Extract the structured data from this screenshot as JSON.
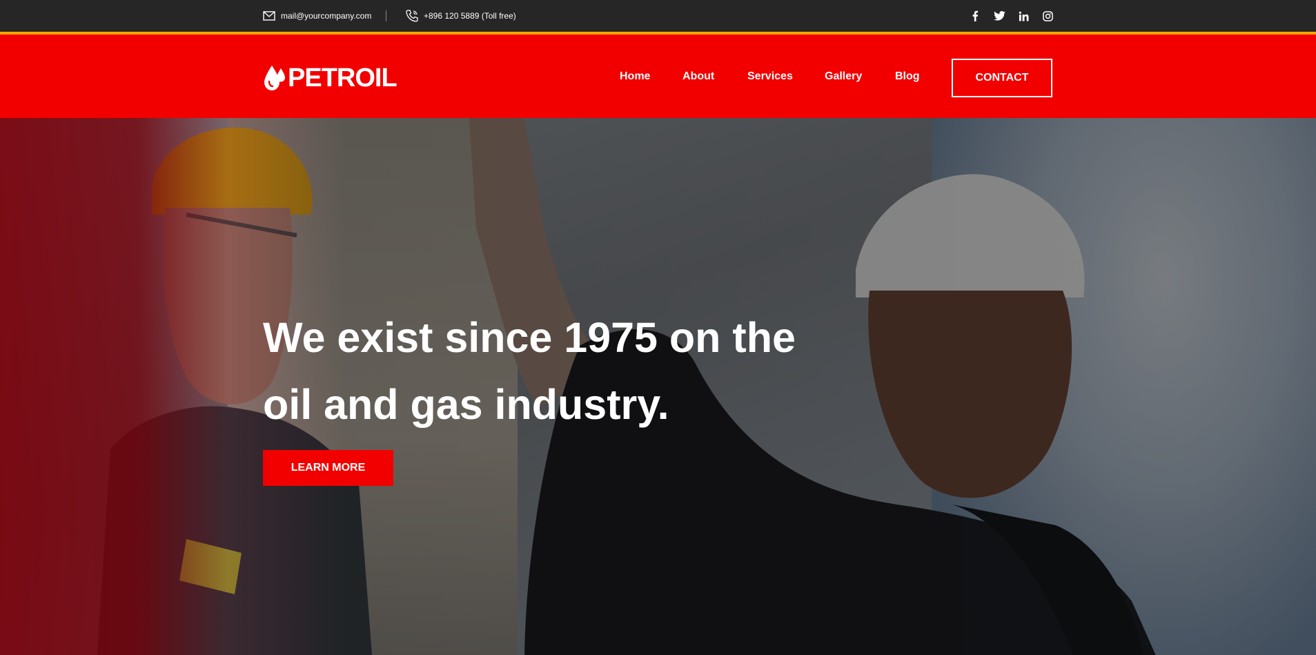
{
  "topbar": {
    "email": "mail@yourcompany.com",
    "phone": "+896 120 5889 (Toll free)",
    "social_icons": [
      "facebook-icon",
      "twitter-icon",
      "linkedin-icon",
      "instagram-icon"
    ]
  },
  "header": {
    "logo_text": "PETROIL",
    "nav": [
      "Home",
      "About",
      "Services",
      "Gallery",
      "Blog"
    ],
    "contact_label": "CONTACT"
  },
  "hero": {
    "title_line1": "We exist since 1975 on the",
    "title_line2": "oil and gas industry.",
    "cta_label": "LEARN MORE"
  },
  "colors": {
    "brand_red": "#f20000",
    "accent_yellow": "#ffa800",
    "topbar_bg": "#262626"
  }
}
